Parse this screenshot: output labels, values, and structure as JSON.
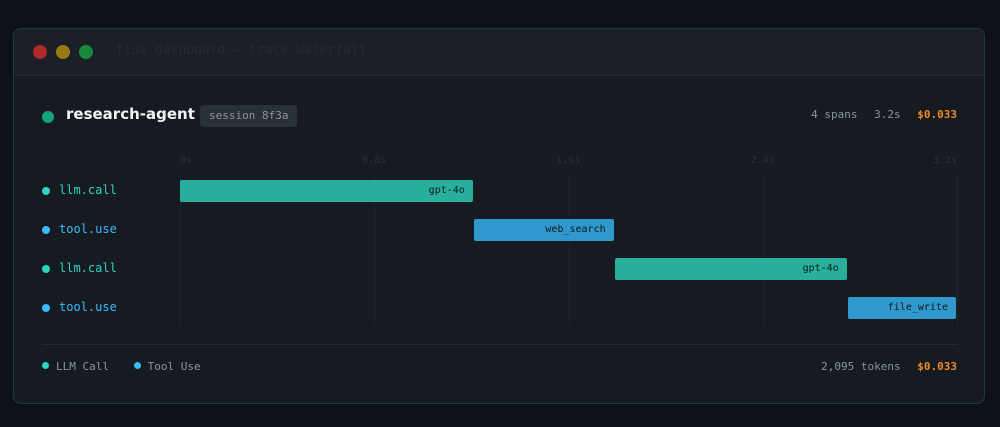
{
  "window": {
    "title": "flux dashboard — trace waterfall",
    "title_color": "#252b34",
    "colors": {
      "llm": "#28b09c",
      "tool": "#2f98cc",
      "llm_dot": "#2dd4bf",
      "tool_dot": "#38bdf8",
      "accent_cost": "#f08a24",
      "agent_dot": "#12a57a"
    }
  },
  "header": {
    "agent_name": "research-agent",
    "session": "session 8f3a",
    "spans": "4 spans",
    "duration": "3.2s",
    "cost": "$0.033"
  },
  "axis": {
    "ticks": [
      "0s",
      "0.8s",
      "1.6s",
      "2.4s",
      "3.2s"
    ],
    "tick_values": [
      0,
      0.8,
      1.6,
      2.4,
      3.2
    ],
    "max": 3.2
  },
  "spans": [
    {
      "type": "llm",
      "label": "llm.call",
      "bar_label": "gpt-4o",
      "start": 0.0,
      "end": 1.21
    },
    {
      "type": "tool",
      "label": "tool.use",
      "bar_label": "web_search",
      "start": 1.21,
      "end": 1.79
    },
    {
      "type": "llm",
      "label": "llm.call",
      "bar_label": "gpt-4o",
      "start": 1.79,
      "end": 2.75
    },
    {
      "type": "tool",
      "label": "tool.use",
      "bar_label": "file_write",
      "start": 2.75,
      "end": 3.2
    }
  ],
  "legend": [
    {
      "type": "llm",
      "label": "LLM Call"
    },
    {
      "type": "tool",
      "label": "Tool Use"
    }
  ],
  "footer": {
    "tokens": "2,095 tokens",
    "cost": "$0.033"
  }
}
